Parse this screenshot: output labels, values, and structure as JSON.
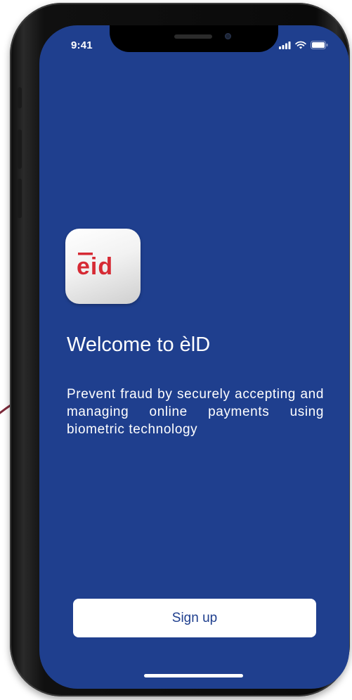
{
  "status_bar": {
    "time": "9:41",
    "icons": [
      "cellular-signal-icon",
      "wifi-icon",
      "battery-icon"
    ]
  },
  "app_icon": {
    "logo_text": "ēid",
    "logo_color": "#d62a34"
  },
  "welcome": {
    "title": "Welcome to èlD",
    "description": "Prevent fraud by securely accepting and managing online payments using biometric technology"
  },
  "actions": {
    "sign_up_label": "Sign up"
  },
  "colors": {
    "background": "#1f3f8e",
    "button_background": "#ffffff",
    "button_text": "#1f3f8e",
    "text": "#ffffff"
  }
}
